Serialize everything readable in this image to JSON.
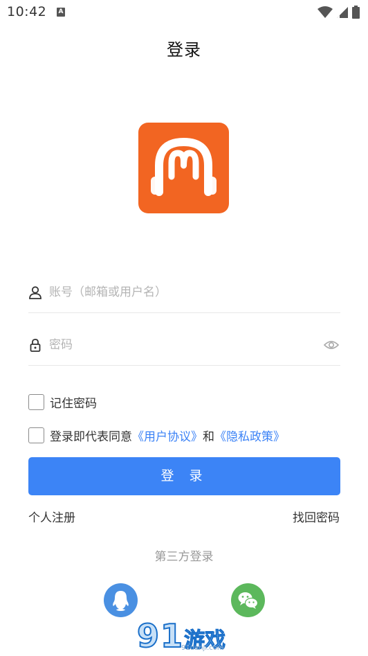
{
  "status_bar": {
    "time": "10:42",
    "notification_icon": "a-notification-icon",
    "icons": [
      "wifi-icon",
      "signal-icon",
      "battery-icon"
    ]
  },
  "header": {
    "title": "登录"
  },
  "logo": {
    "icon": "headphones-logo-icon",
    "color": "#f26522"
  },
  "form": {
    "account_placeholder": "账号（邮箱或用户名）",
    "account_value": "",
    "password_placeholder": "密码",
    "password_value": ""
  },
  "remember": {
    "label": "记住密码",
    "checked": false
  },
  "agreement": {
    "prefix": "登录即代表同意",
    "user_agreement": "《用户协议》",
    "and": "和",
    "privacy_policy": "《隐私政策》",
    "checked": false
  },
  "login_button": {
    "label": "登 录",
    "color": "#3c84f6"
  },
  "links": {
    "register": "个人注册",
    "forgot": "找回密码"
  },
  "third_party": {
    "title": "第三方登录",
    "providers": [
      {
        "name": "qq-icon",
        "color": "#4a90e2"
      },
      {
        "name": "wechat-icon",
        "color": "#5cb85c"
      }
    ]
  },
  "watermark": {
    "text": "游戏",
    "url": "91danji.com"
  }
}
